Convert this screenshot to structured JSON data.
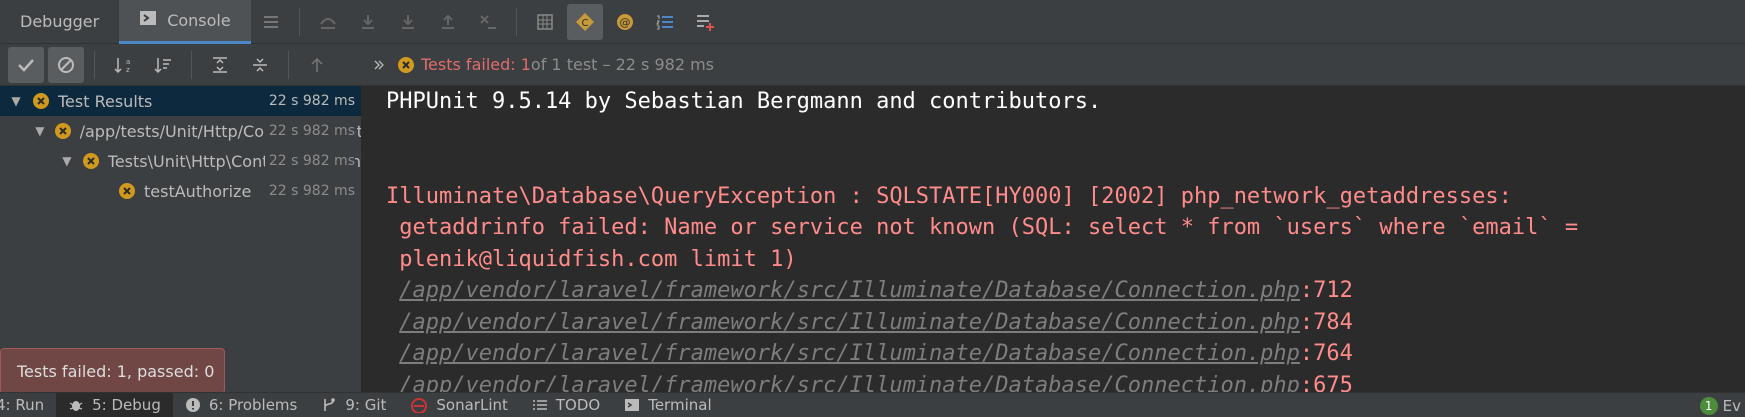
{
  "tabs": {
    "debugger": "Debugger",
    "console": "Console"
  },
  "summary": {
    "failed_label": "Tests failed: 1",
    "rest": " of 1 test – 22 s 982 ms"
  },
  "tree": [
    {
      "label": "Test Results",
      "duration": "22 s 982 ms"
    },
    {
      "label": "/app/tests/Unit/Http/Controllers/AuthTest.php",
      "duration": "22 s 982 ms"
    },
    {
      "label": "Tests\\Unit\\Http\\Controllers\\AuthTest",
      "duration": "22 s 982 ms"
    },
    {
      "label": "testAuthorize",
      "duration": "22 s 982 ms"
    }
  ],
  "console": {
    "line1": "PHPUnit 9.5.14 by Sebastian Bergmann and contributors.",
    "err1": "Illuminate\\Database\\QueryException : SQLSTATE[HY000] [2002] php_network_getaddresses:",
    "err2": " getaddrinfo failed: Name or service not known (SQL: select * from `users` where `email` =",
    "err3": " plenik@liquidfish.com limit 1)",
    "trace": [
      {
        "path": "/app/vendor/laravel/framework/src/Illuminate/Database/Connection.php",
        "line": ":712"
      },
      {
        "path": "/app/vendor/laravel/framework/src/Illuminate/Database/Connection.php",
        "line": ":784"
      },
      {
        "path": "/app/vendor/laravel/framework/src/Illuminate/Database/Connection.php",
        "line": ":764"
      },
      {
        "path": "/app/vendor/laravel/framework/src/Illuminate/Database/Connection.php",
        "line": ":675"
      }
    ]
  },
  "tooltip": "Tests failed: 1, passed: 0",
  "bottombar": {
    "run": "4: Run",
    "debug": "5: Debug",
    "problems": "6: Problems",
    "git": "9: Git",
    "sonarlint": "SonarLint",
    "todo": "TODO",
    "terminal": "Terminal",
    "event_count": "1",
    "event_label": "Ev"
  },
  "colors": {
    "fail_icon": "#d19a1f",
    "error_text": "#ff8b8b",
    "accent": "#4a88c7"
  }
}
